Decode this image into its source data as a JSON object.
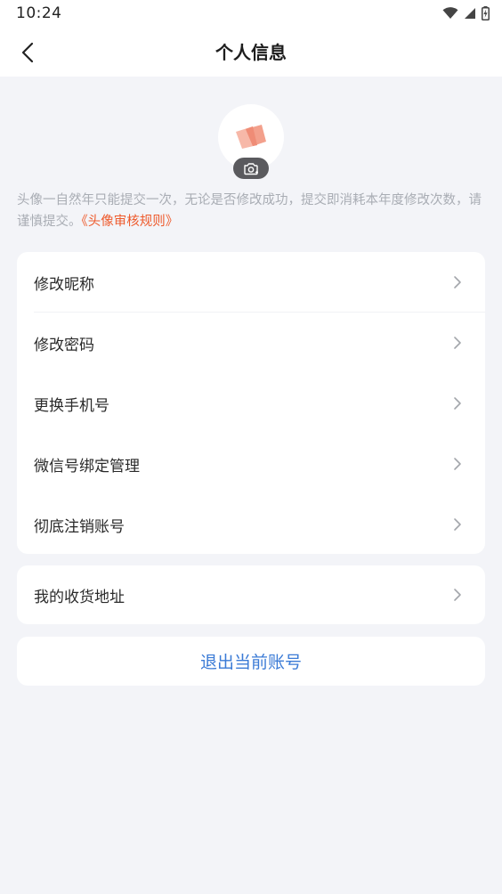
{
  "status_bar": {
    "time": "10:24",
    "icons": [
      "wifi-icon",
      "signal-icon",
      "battery-charging-icon"
    ]
  },
  "header": {
    "title": "个人信息",
    "back_icon": "chevron-left-icon"
  },
  "avatar": {
    "camera_icon": "camera-icon",
    "notice": "头像一自然年只能提交一次，无论是否修改成功，提交即消耗本年度修改次数，请谨慎提交。",
    "rules_link": "《头像审核规则》"
  },
  "account_settings": {
    "items": [
      {
        "label": "修改昵称"
      },
      {
        "label": "修改密码"
      },
      {
        "label": "更换手机号"
      },
      {
        "label": "微信号绑定管理"
      },
      {
        "label": "彻底注销账号"
      }
    ]
  },
  "address": {
    "label": "我的收货地址"
  },
  "logout": {
    "label": "退出当前账号"
  },
  "colors": {
    "background": "#f3f4f8",
    "card": "#ffffff",
    "link": "#ee5a2c",
    "logout_text": "#3b7bd6",
    "notice_text": "#a9adb4"
  }
}
